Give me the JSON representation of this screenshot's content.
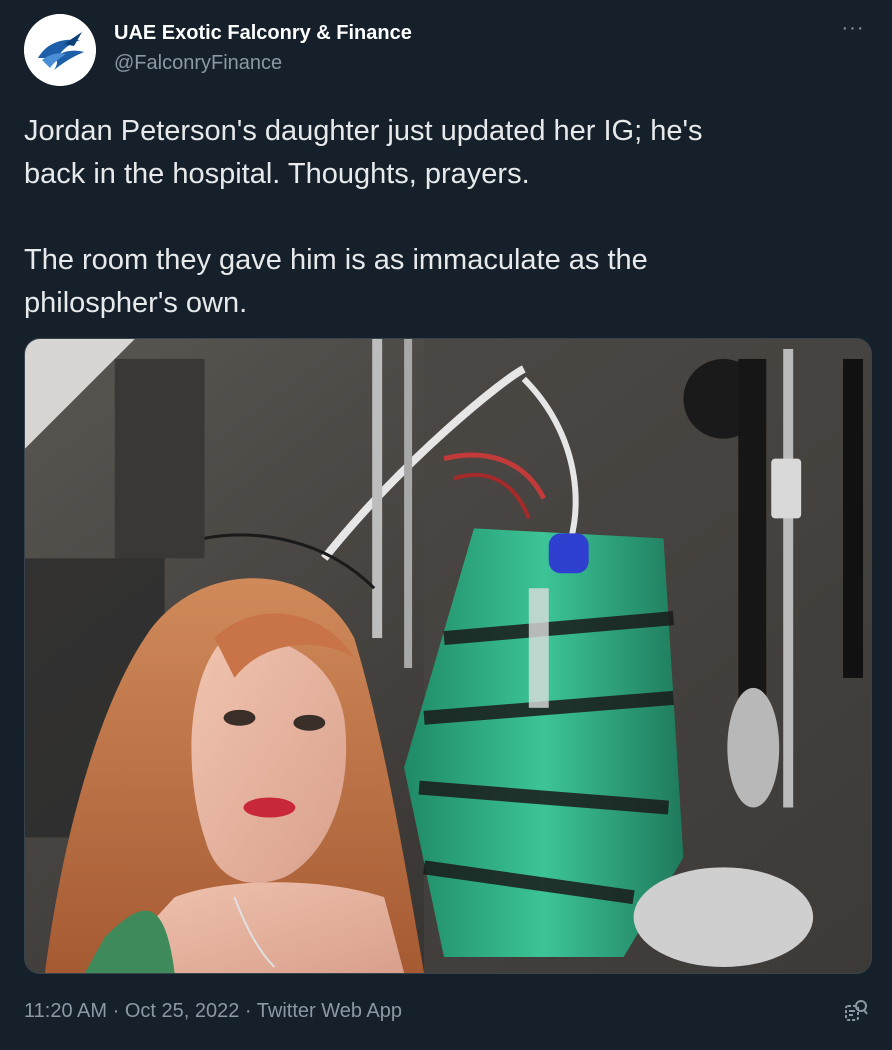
{
  "tweet": {
    "author_name": "UAE Exotic Falconry & Finance",
    "author_handle": "@FalconryFinance",
    "text": "Jordan Peterson's daughter just updated her IG; he's\nback in the hospital. Thoughts, prayers.\n\nThe room they gave him is as immaculate as the\nphilospher's own.",
    "time": "11:20 AM",
    "date": "Oct 25, 2022",
    "source": "Twitter Web App",
    "separator": " · ",
    "more_label": "···"
  },
  "icons": {
    "avatar": "falcon-logo",
    "more": "more-options-icon",
    "analytics": "tweet-analytics-icon"
  },
  "colors": {
    "background": "#15202b",
    "secondary_text": "#8b98a5",
    "primary_text": "#e7e9ea",
    "logo_blue": "#1d5fa8",
    "bag_green": "#2fa57c"
  }
}
